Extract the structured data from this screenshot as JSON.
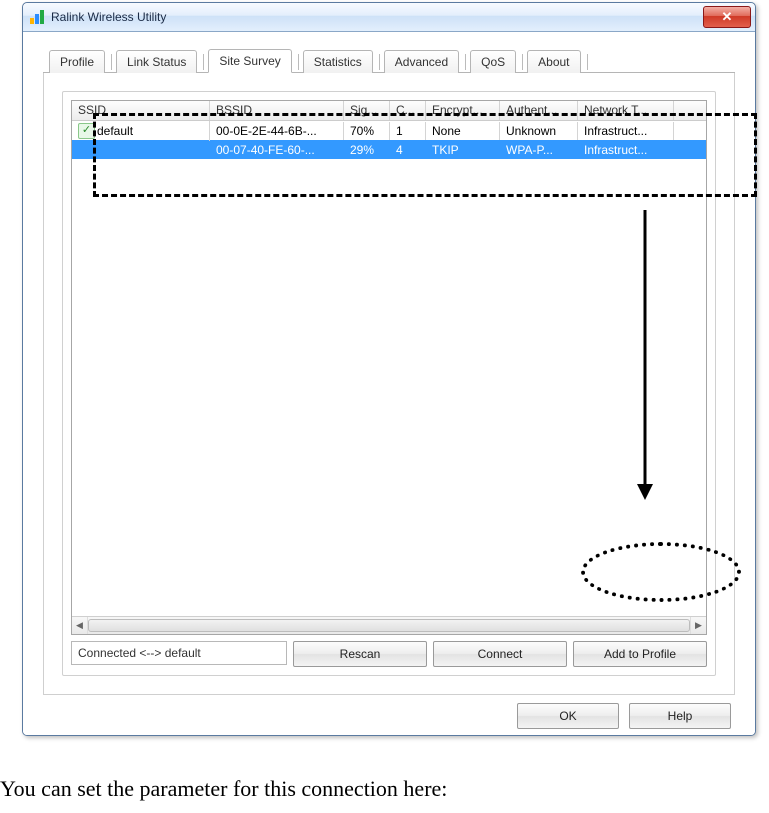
{
  "window": {
    "title": "Ralink Wireless Utility"
  },
  "tabs": [
    {
      "label": "Profile",
      "active": false
    },
    {
      "label": "Link Status",
      "active": false
    },
    {
      "label": "Site Survey",
      "active": true
    },
    {
      "label": "Statistics",
      "active": false
    },
    {
      "label": "Advanced",
      "active": false
    },
    {
      "label": "QoS",
      "active": false
    },
    {
      "label": "About",
      "active": false
    }
  ],
  "columns": [
    "SSID",
    "BSSID",
    "Sig...",
    "C...",
    "Encrypt...",
    "Authent...",
    "Network T..."
  ],
  "rows": [
    {
      "selected": false,
      "icon": true,
      "ssid": "default",
      "bssid": "00-0E-2E-44-6B-...",
      "signal": "70%",
      "channel": "1",
      "encrypt": "None",
      "auth": "Unknown",
      "net": "Infrastruct..."
    },
    {
      "selected": true,
      "icon": false,
      "ssid": "",
      "bssid": "00-07-40-FE-60-...",
      "signal": "29%",
      "channel": "4",
      "encrypt": "TKIP",
      "auth": "WPA-P...",
      "net": "Infrastruct..."
    }
  ],
  "status_text": "Connected <--> default",
  "buttons": {
    "rescan": "Rescan",
    "connect": "Connect",
    "add_profile": "Add to Profile",
    "ok": "OK",
    "help": "Help"
  },
  "caption": "You can set the parameter for this connection here:"
}
